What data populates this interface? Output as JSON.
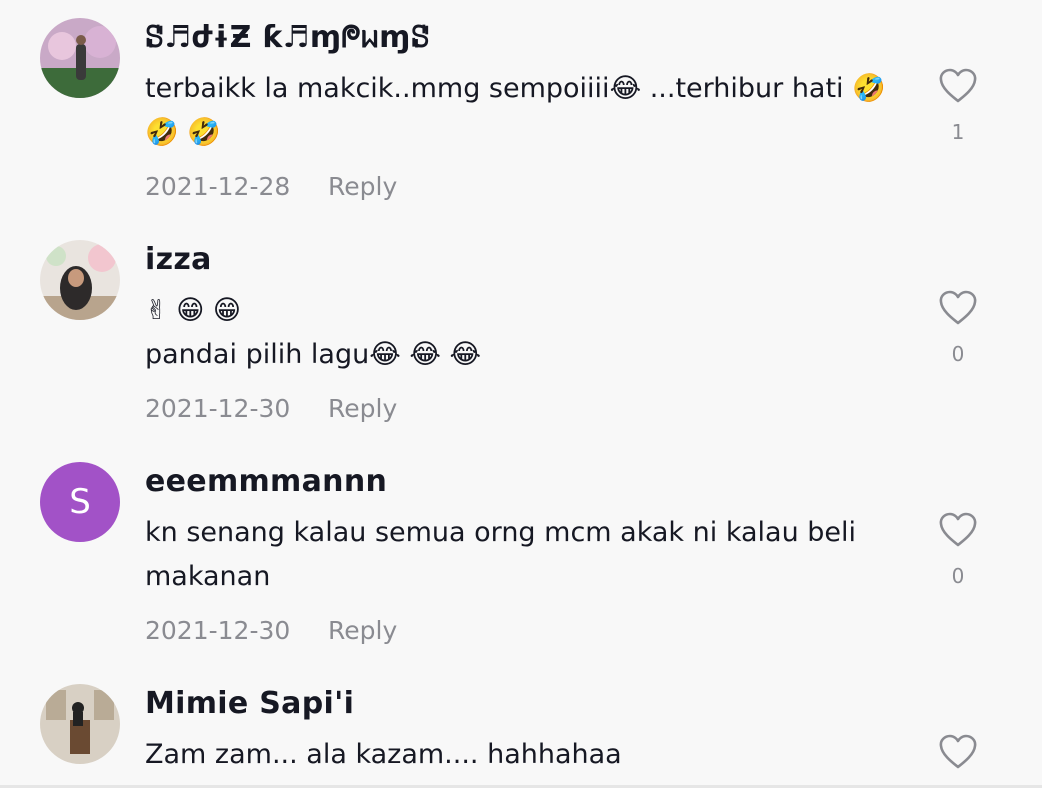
{
  "comments": [
    {
      "username": "ꗟ♬ժɨƵ ƙ♬ɱᖘᥕɱꗟ",
      "text": "terbaikk la makcik..mmg sempoiiii😂 ...terhibur hati 🤣\n🤣 🤣",
      "date": "2021-12-28",
      "reply_label": "Reply",
      "likes": "1"
    },
    {
      "username": "izza",
      "text": "✌ 😁 😁\npandai pilih lagu😂 😂 😂",
      "date": "2021-12-30",
      "reply_label": "Reply",
      "likes": "0"
    },
    {
      "username": "eeemmmannn",
      "avatar_letter": "S",
      "avatar_color": "#a252c7",
      "text": "kn senang kalau semua orng mcm akak ni kalau beli\nmakanan",
      "date": "2021-12-30",
      "reply_label": "Reply",
      "likes": "0"
    },
    {
      "username": "Mimie Sapi'i",
      "text": "Zam zam... ala kazam.... hahhahaa"
    }
  ],
  "icons": {
    "like": "heart-outline-icon"
  },
  "colors": {
    "text": "#161823",
    "secondary": "#8a8b91",
    "background": "#f8f8f8"
  }
}
